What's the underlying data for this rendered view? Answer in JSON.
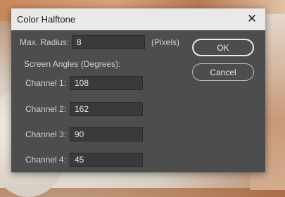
{
  "dialog": {
    "title": "Color Halftone",
    "close_icon": "close-icon",
    "max_radius": {
      "label": "Max. Radius:",
      "value": "8",
      "unit": "(Pixels)"
    },
    "screen_angles_heading": "Screen Angles (Degrees):",
    "channels": [
      {
        "label": "Channel 1:",
        "value": "108"
      },
      {
        "label": "Channel 2:",
        "value": "162"
      },
      {
        "label": "Channel 3:",
        "value": "90"
      },
      {
        "label": "Channel 4:",
        "value": "45"
      }
    ],
    "ok_label": "OK",
    "cancel_label": "Cancel"
  },
  "colors": {
    "dialog_bg": "#4d4d4d",
    "titlebar_bg": "#e9e9e9",
    "field_bg": "#3a3a3a",
    "text": "#cfcfcf"
  }
}
